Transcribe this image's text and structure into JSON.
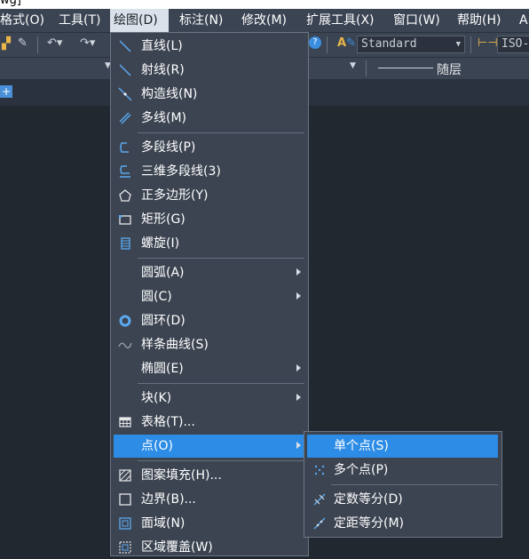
{
  "titlebar": {
    "fragment": "wg]"
  },
  "menubar": {
    "items": [
      {
        "label": "格式(O)"
      },
      {
        "label": "工具(T)"
      },
      {
        "label": "绘图(D)"
      },
      {
        "label": "标注(N)"
      },
      {
        "label": "修改(M)"
      },
      {
        "label": "扩展工具(X)"
      },
      {
        "label": "窗口(W)"
      },
      {
        "label": "帮助(H)"
      },
      {
        "label": "A"
      }
    ]
  },
  "toolbar": {
    "text_style": "Standard",
    "dim_style": "ISO-",
    "linetype": "随层",
    "help_icon": "?"
  },
  "draw_menu": {
    "items": [
      {
        "label": "直线(L)",
        "icon": "line-icon"
      },
      {
        "label": "射线(R)",
        "icon": "ray-icon"
      },
      {
        "label": "构造线(N)",
        "icon": "xline-icon"
      },
      {
        "label": "多线(M)",
        "icon": "multiline-icon"
      },
      {
        "label": "多段线(P)",
        "icon": "polyline-icon"
      },
      {
        "label": "三维多段线(3)",
        "icon": "3d-polyline-icon"
      },
      {
        "label": "正多边形(Y)",
        "icon": "polygon-icon"
      },
      {
        "label": "矩形(G)",
        "icon": "rectangle-icon"
      },
      {
        "label": "螺旋(I)",
        "icon": "helix-icon"
      },
      {
        "label": "圆弧(A)",
        "icon": ""
      },
      {
        "label": "圆(C)",
        "icon": ""
      },
      {
        "label": "圆环(D)",
        "icon": "donut-icon"
      },
      {
        "label": "样条曲线(S)",
        "icon": "spline-icon"
      },
      {
        "label": "椭圆(E)",
        "icon": ""
      },
      {
        "label": "块(K)",
        "icon": ""
      },
      {
        "label": "表格(T)...",
        "icon": "table-icon"
      },
      {
        "label": "点(O)",
        "icon": ""
      },
      {
        "label": "图案填充(H)...",
        "icon": "hatch-icon"
      },
      {
        "label": "边界(B)...",
        "icon": "boundary-icon"
      },
      {
        "label": "面域(N)",
        "icon": "region-icon"
      },
      {
        "label": "区域覆盖(W)",
        "icon": "wipeout-icon"
      }
    ]
  },
  "point_submenu": {
    "items": [
      {
        "label": "单个点(S)",
        "icon": "single-point-icon"
      },
      {
        "label": "多个点(P)",
        "icon": "multiple-points-icon"
      },
      {
        "label": "定数等分(D)",
        "icon": "divide-icon"
      },
      {
        "label": "定距等分(M)",
        "icon": "measure-icon"
      }
    ]
  },
  "colors": {
    "accent": "#2c8ce6",
    "menu_bg": "#3c4451",
    "canvas": "#212830"
  }
}
